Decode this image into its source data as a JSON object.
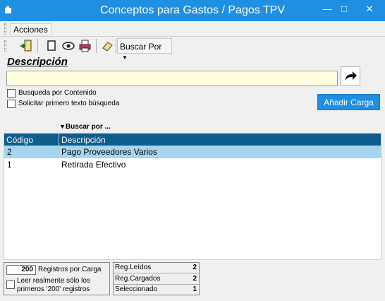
{
  "window": {
    "title": "Conceptos para Gastos / Pagos TPV",
    "accent": "#1e8fe1"
  },
  "menubar": {
    "acciones": "Acciones"
  },
  "toolbar": {
    "buttons": [
      "exit-door-icon",
      "new-document-icon",
      "view-eye-icon",
      "print-icon",
      "eraser-icon"
    ],
    "buscar_por": "Buscar Por"
  },
  "search": {
    "label": "Descripción",
    "value": "",
    "go_icon": "redo-arrow-icon"
  },
  "options": {
    "busqueda_contenido": "Busqueda por Contenido",
    "solicitar_primero": "Solicitar primero texto búsqueda"
  },
  "add_button": "Añadir Carga",
  "grid": {
    "sort_hint": "Buscar por ...",
    "columns": [
      "Código",
      "Descripción"
    ],
    "header_color": "#0f5d8c",
    "selected_color": "#a6d5ee",
    "rows": [
      {
        "code": "2",
        "desc": "Pago Proveedores Varios",
        "selected": true
      },
      {
        "code": "1",
        "desc": "Retirada Efectivo",
        "selected": false
      }
    ]
  },
  "status": {
    "registros_count": "200",
    "registros_label": "Registros por Carga",
    "leer_label": "Leer realmente sólo los primeros '200' registros",
    "reg_leidos_label": "Reg.Leídos",
    "reg_leidos_value": "2",
    "reg_cargados_label": "Reg.Cargados",
    "reg_cargados_value": "2",
    "seleccionado_label": "Seleccionado",
    "seleccionado_value": "1"
  }
}
